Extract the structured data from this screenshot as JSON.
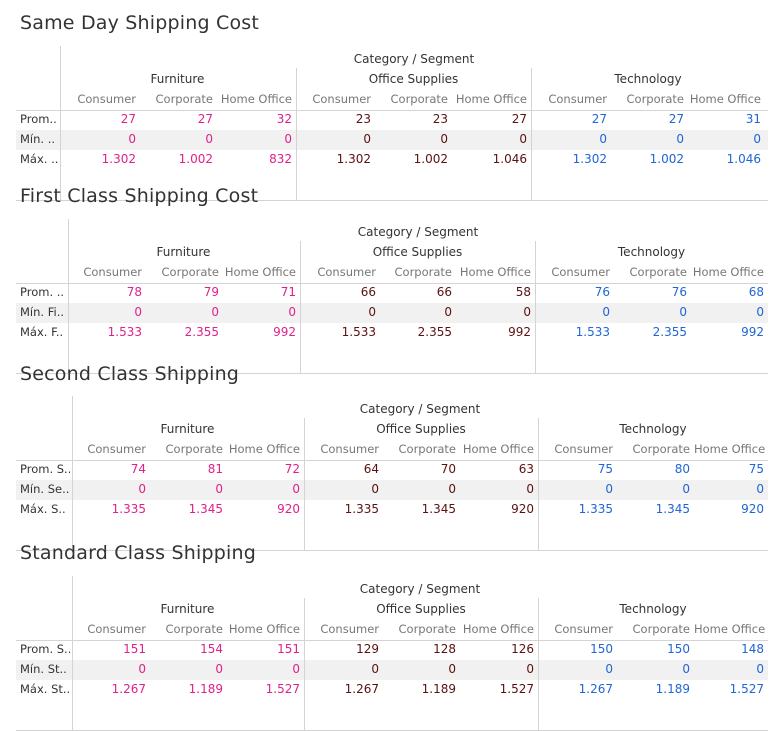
{
  "header": {
    "caption": "Category / Segment"
  },
  "categories": [
    "Furniture",
    "Office Supplies",
    "Technology"
  ],
  "segments": [
    "Consumer",
    "Corporate",
    "Home Office"
  ],
  "colors": {
    "Furniture": "#e0218a",
    "Office Supplies": "#5a1111",
    "Technology": "#2066d6"
  },
  "sections": [
    {
      "title": "Same Day Shipping Cost",
      "rows": [
        {
          "label": "Prom..",
          "values": [
            "27",
            "27",
            "32",
            "23",
            "23",
            "27",
            "27",
            "27",
            "31"
          ]
        },
        {
          "label": "Mín. ..",
          "values": [
            "0",
            "0",
            "0",
            "0",
            "0",
            "0",
            "0",
            "0",
            "0"
          ]
        },
        {
          "label": "Máx. ..",
          "values": [
            "1.302",
            "1.002",
            "832",
            "1.302",
            "1.002",
            "1.046",
            "1.302",
            "1.002",
            "1.046"
          ]
        }
      ]
    },
    {
      "title": "First Class Shipping Cost",
      "rows": [
        {
          "label": "Prom. ..",
          "values": [
            "78",
            "79",
            "71",
            "66",
            "66",
            "58",
            "76",
            "76",
            "68"
          ]
        },
        {
          "label": "Mín. Fi..",
          "values": [
            "0",
            "0",
            "0",
            "0",
            "0",
            "0",
            "0",
            "0",
            "0"
          ]
        },
        {
          "label": "Máx. F..",
          "values": [
            "1.533",
            "2.355",
            "992",
            "1.533",
            "2.355",
            "992",
            "1.533",
            "2.355",
            "992"
          ]
        }
      ]
    },
    {
      "title": "Second Class Shipping",
      "rows": [
        {
          "label": "Prom. S..",
          "values": [
            "74",
            "81",
            "72",
            "64",
            "70",
            "63",
            "75",
            "80",
            "75"
          ]
        },
        {
          "label": "Mín. Se..",
          "values": [
            "0",
            "0",
            "0",
            "0",
            "0",
            "0",
            "0",
            "0",
            "0"
          ]
        },
        {
          "label": "Máx. S..",
          "values": [
            "1.335",
            "1.345",
            "920",
            "1.335",
            "1.345",
            "920",
            "1.335",
            "1.345",
            "920"
          ]
        }
      ]
    },
    {
      "title": "Standard Class Shipping",
      "rows": [
        {
          "label": "Prom. S..",
          "values": [
            "151",
            "154",
            "151",
            "129",
            "128",
            "126",
            "150",
            "150",
            "148"
          ]
        },
        {
          "label": "Mín. St..",
          "values": [
            "0",
            "0",
            "0",
            "0",
            "0",
            "0",
            "0",
            "0",
            "0"
          ]
        },
        {
          "label": "Máx. St..",
          "values": [
            "1.267",
            "1.189",
            "1.527",
            "1.267",
            "1.189",
            "1.527",
            "1.267",
            "1.189",
            "1.527"
          ]
        }
      ]
    }
  ]
}
